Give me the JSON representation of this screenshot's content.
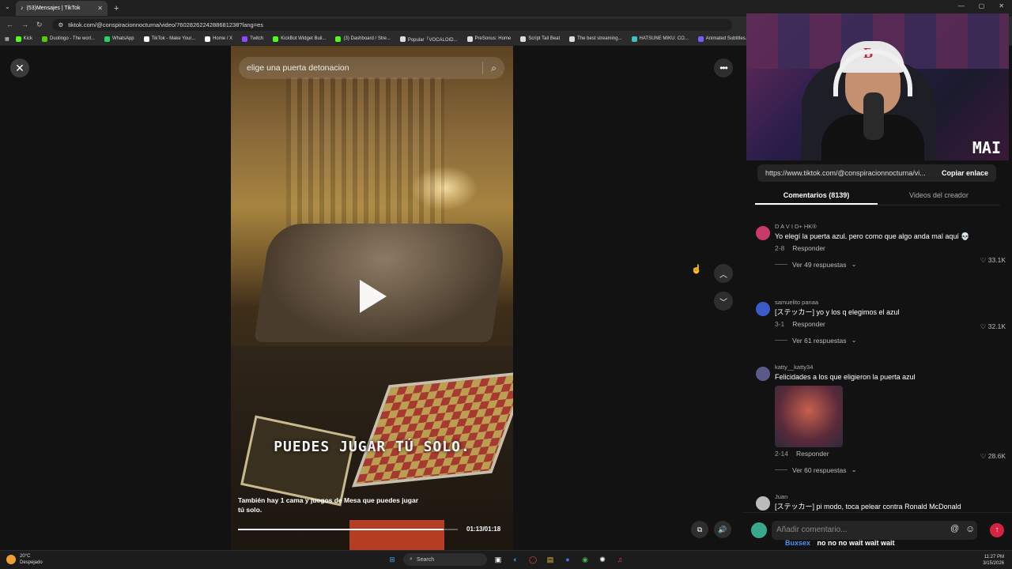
{
  "browser": {
    "tab_title": "(53)Mensajes | TikTok",
    "url": "tiktok.com/@conspiracionnocturna/video/7602826224288681238?lang=es",
    "bookmarks": [
      {
        "label": "Kick",
        "color": "#53fc18"
      },
      {
        "label": "Duolingo - The worl...",
        "color": "#58cc02"
      },
      {
        "label": "WhatsApp",
        "color": "#25d366"
      },
      {
        "label": "TikTok - Make Your...",
        "color": "#ffffff"
      },
      {
        "label": "Home / X",
        "color": "#ffffff"
      },
      {
        "label": "Twitch",
        "color": "#9146ff"
      },
      {
        "label": "KickBot Widget Buil...",
        "color": "#53fc18"
      },
      {
        "label": "(3) Dashboard / Stre...",
        "color": "#53fc18"
      },
      {
        "label": "Popular「VOCALOID...",
        "color": "#dddddd"
      },
      {
        "label": "PreSonus: Home",
        "color": "#dddddd"
      },
      {
        "label": "Script Tail Beat",
        "color": "#dddddd"
      },
      {
        "label": "The best streaming...",
        "color": "#dddddd"
      },
      {
        "label": "HATSUNE MIKU: CO...",
        "color": "#39c5bb"
      },
      {
        "label": "Animated Subtitles...",
        "color": "#7b5cff"
      }
    ]
  },
  "video": {
    "search_text": "elige una puerta detonacion",
    "subtitle": "PUEDES JUGAR TÚ SOLO.",
    "caption": "También hay 1 cama y juegos de Mesa que puedes jugar tú solo.",
    "time": "01:13/01:18",
    "progress_fraction": 0.936
  },
  "panel": {
    "share_url": "https://www.tiktok.com/@conspiracionnocturna/vi...",
    "copy_label": "Copiar enlace",
    "tab_comments": "Comentarios (8139)",
    "tab_creator": "Videos del creador",
    "webcam_logo": "MAI",
    "comments": [
      {
        "user": "D A V I D+ HK®",
        "text": "Yo elegí la puerta azul. pero como que algo anda mal aquí 💀",
        "date": "2-8",
        "reply": "Responder",
        "likes": "33.1K",
        "replies": "Ver 49 respuestas",
        "avatar": "#c83a6a"
      },
      {
        "user": "samuelito panaa",
        "text": "[ステッカー] yo y los q elegimos el azul",
        "date": "3-1",
        "reply": "Responder",
        "likes": "32.1K",
        "replies": "Ver 61 respuestas",
        "avatar": "#3a5cc8"
      },
      {
        "user": "katty__katty34",
        "text": "Felicidades a los que eligieron la puerta azul",
        "date": "2-14",
        "reply": "Responder",
        "likes": "28.6K",
        "replies": "Ver 60 respuestas",
        "avatar": "#5a5a8a"
      },
      {
        "user": "Juan",
        "text": "[ステッカー] pi modo, toca pelear contra Ronald McDonald",
        "avatar": "#bbbbbb"
      }
    ],
    "input_placeholder": "Añadir comentario...",
    "chat_user": "Buxsex",
    "chat_text": "no no no wait wait wait"
  },
  "taskbar": {
    "temp": "20°C",
    "weather": "Despejado",
    "search": "Search",
    "time": "11:27 PM",
    "date": "3/15/2026"
  }
}
